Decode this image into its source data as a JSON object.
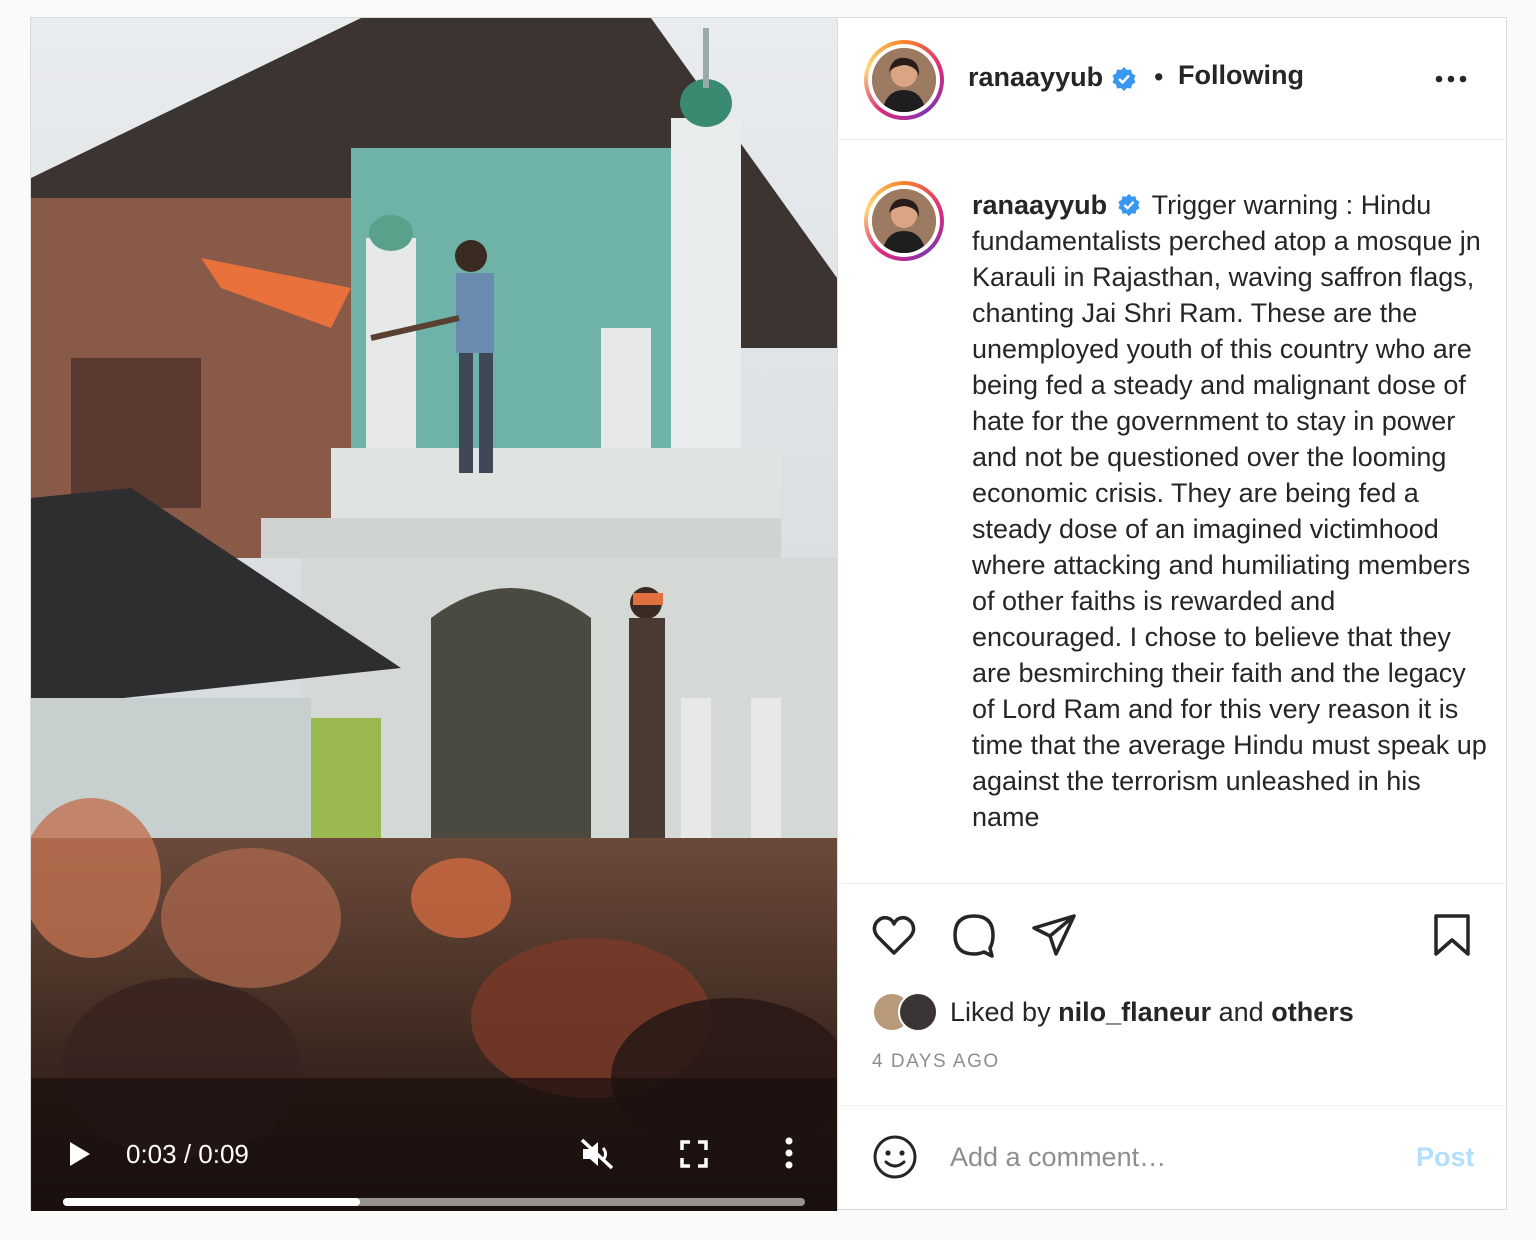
{
  "video": {
    "time_display": "0:03 / 0:09",
    "progress": 0.4,
    "controls": {
      "play_icon": "play-icon",
      "mute_icon": "muted-speaker-icon",
      "fullscreen_icon": "fullscreen-icon",
      "menu_icon": "vertical-dots-icon"
    }
  },
  "header": {
    "username": "ranaayyub",
    "separator": "•",
    "follow_status": "Following",
    "verified_color": "#3897f0"
  },
  "caption": {
    "username": "ranaayyub",
    "text": "Trigger warning : Hindu fundamentalists perched atop a mosque jn Karauli in Rajasthan, waving saffron flags, chanting Jai Shri Ram. These are the unemployed youth of this country who are being fed a steady and malignant dose of hate for the government to stay in power and not be questioned over the looming economic crisis. They are being fed a steady dose of an imagined victimhood where attacking and humiliating members of other faiths is rewarded and encouraged. I chose to believe that they are besmirching their faith and the legacy of Lord Ram and for this very reason it is time that the average Hindu must speak up against the terrorism unleashed in his name"
  },
  "actions": {
    "icons": [
      "heart-icon",
      "comment-icon",
      "share-icon",
      "bookmark-icon"
    ]
  },
  "likes": {
    "prefix": "Liked by",
    "user": "nilo_flaneur",
    "connector": "and",
    "others": "others"
  },
  "timestamp": "4 DAYS AGO",
  "comment": {
    "placeholder": "Add a comment…",
    "post_label": "Post",
    "post_color": "#b2dffc"
  }
}
